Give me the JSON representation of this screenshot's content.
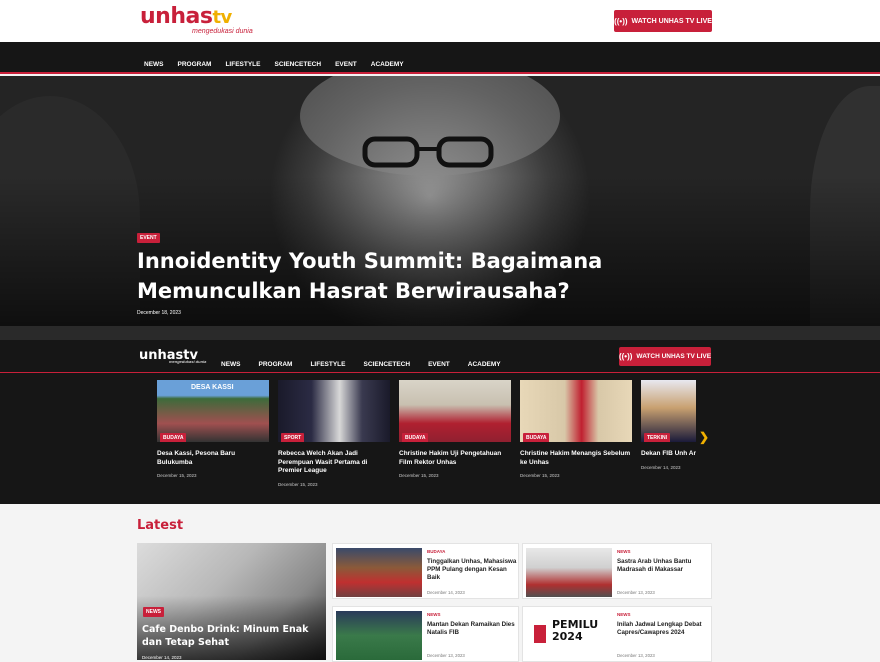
{
  "header": {
    "logo_text": "unhas",
    "logo_tv": "tv",
    "logo_tagline": "mengedukasi dunia",
    "live_button": "WATCH UNHAS TV LIVE"
  },
  "nav": [
    "NEWS",
    "PROGRAM",
    "LIFESTYLE",
    "SCIENCETECH",
    "EVENT",
    "ACADEMY"
  ],
  "hero": {
    "category": "EVENT",
    "title": "Innoidentity Youth Summit: Bagaimana Memunculkan Hasrat Berwirausaha?",
    "date": "December 18, 2023"
  },
  "sticky_header": {
    "logo_text": "unhastv",
    "logo_tagline": "mengedukasi dunia",
    "live_button": "WATCH UNHAS TV LIVE"
  },
  "carousel": [
    {
      "category": "BUDAYA",
      "title": "Desa Kassi, Pesona Baru Bulukumba",
      "date": "December 15, 2023",
      "image_text": "DESA KASSI"
    },
    {
      "category": "SPORT",
      "title": "Rebecca Welch Akan Jadi Perempuan Wasit Pertama di Premier League",
      "date": "December 15, 2023"
    },
    {
      "category": "BUDAYA",
      "title": "Christine Hakim Uji Pengetahuan Film Rektor Unhas",
      "date": "December 15, 2023"
    },
    {
      "category": "BUDAYA",
      "title": "Christine Hakim Menangis Sebelum ke Unhas",
      "date": "December 15, 2023"
    },
    {
      "category": "TERKINI",
      "title": "Dekan FIB Unh Anak Sulungn",
      "date": "December 14, 2023"
    }
  ],
  "latest": {
    "heading": "Latest",
    "featured": {
      "category": "NEWS",
      "title": "Cafe Denbo Drink: Minum Enak dan Tetap Sehat",
      "date": "December 14, 2023"
    },
    "items": [
      {
        "category": "BUDAYA",
        "title": "Tinggalkan Unhas, Mahasiswa PPM Pulang dengan Kesan Baik",
        "date": "December 14, 2023"
      },
      {
        "category": "NEWS",
        "title": "Sastra Arab Unhas Bantu Madrasah di Makassar",
        "date": "December 13, 2023"
      },
      {
        "category": "NEWS",
        "title": "Mantan Dekan Ramaikan Dies Natalis FIB",
        "date": "December 13, 2023"
      },
      {
        "category": "NEWS",
        "title": "Inilah Jadwal Lengkap Debat Capres/Cawapres 2024",
        "date": "December 13, 2023",
        "image_text": "PEMILU 2024"
      }
    ]
  },
  "colors": {
    "brand": "#c8203a",
    "accent": "#f0b000",
    "dark": "#161616"
  },
  "icons": {
    "live": "broadcast-icon",
    "next": "chevron-right-icon"
  }
}
